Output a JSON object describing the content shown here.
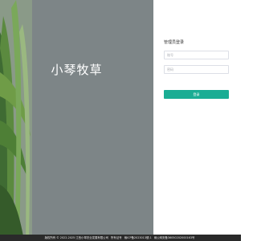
{
  "brand": {
    "title": "小琴牧草"
  },
  "login": {
    "heading": "管理员登录",
    "username_placeholder": "账号",
    "password_placeholder": "密码",
    "submit_label": "登录"
  },
  "footer": {
    "copyright": "版权所有 © 2022-2025 江西小琴农业发展有限公司",
    "record_label": "所有证号",
    "icp": "赣ICP备2023013號-1",
    "police": "赣公网安备36050202000163号"
  },
  "colors": {
    "hero_overlay": "#7d8587",
    "primary_button": "#1aad94",
    "footer_bg": "#2a2a2a"
  }
}
